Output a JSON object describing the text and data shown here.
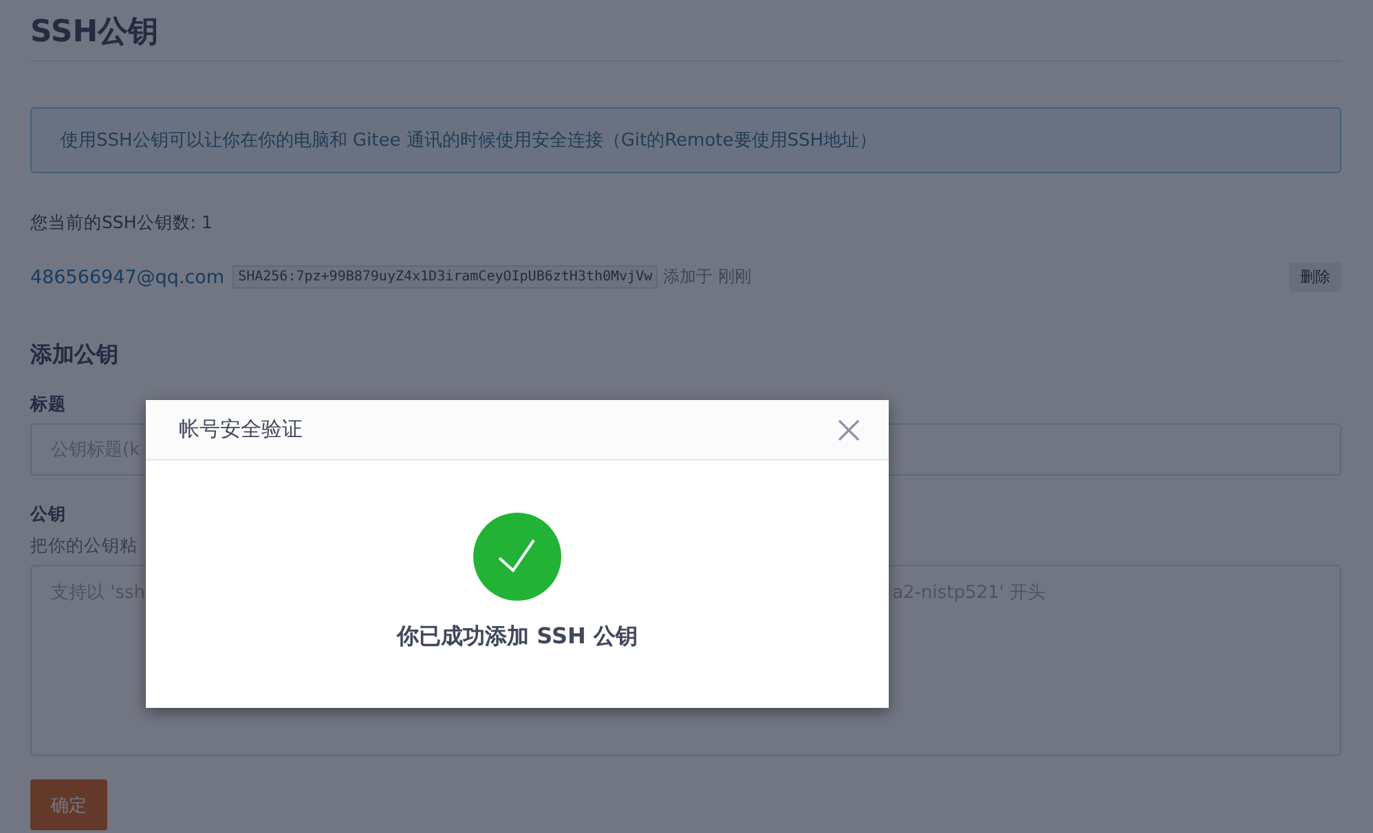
{
  "page": {
    "title": "SSH公钥",
    "notice": "使用SSH公钥可以让你在你的电脑和 Gitee 通讯的时候使用安全连接（Git的Remote要使用SSH地址）",
    "key_count": "您当前的SSH公钥数: 1",
    "keys": [
      {
        "email": "486566947@qq.com",
        "fingerprint": "SHA256:7pz+99B879uyZ4x1D3iramCeyOIpUB6ztH3th0MvjVw",
        "added": "添加于 刚刚",
        "delete_label": "删除"
      }
    ],
    "add_section": {
      "heading": "添加公钥",
      "title_label": "标题",
      "title_placeholder": "公钥标题(k",
      "key_label": "公钥",
      "key_hint": "把你的公钥粘",
      "key_placeholder_start": "支持以 'ssh",
      "key_placeholder_end": "a2-nistp521' 开头",
      "submit": "确定"
    }
  },
  "dialog": {
    "title": "帐号安全验证",
    "message": "你已成功添加 SSH 公钥",
    "success": true
  }
}
